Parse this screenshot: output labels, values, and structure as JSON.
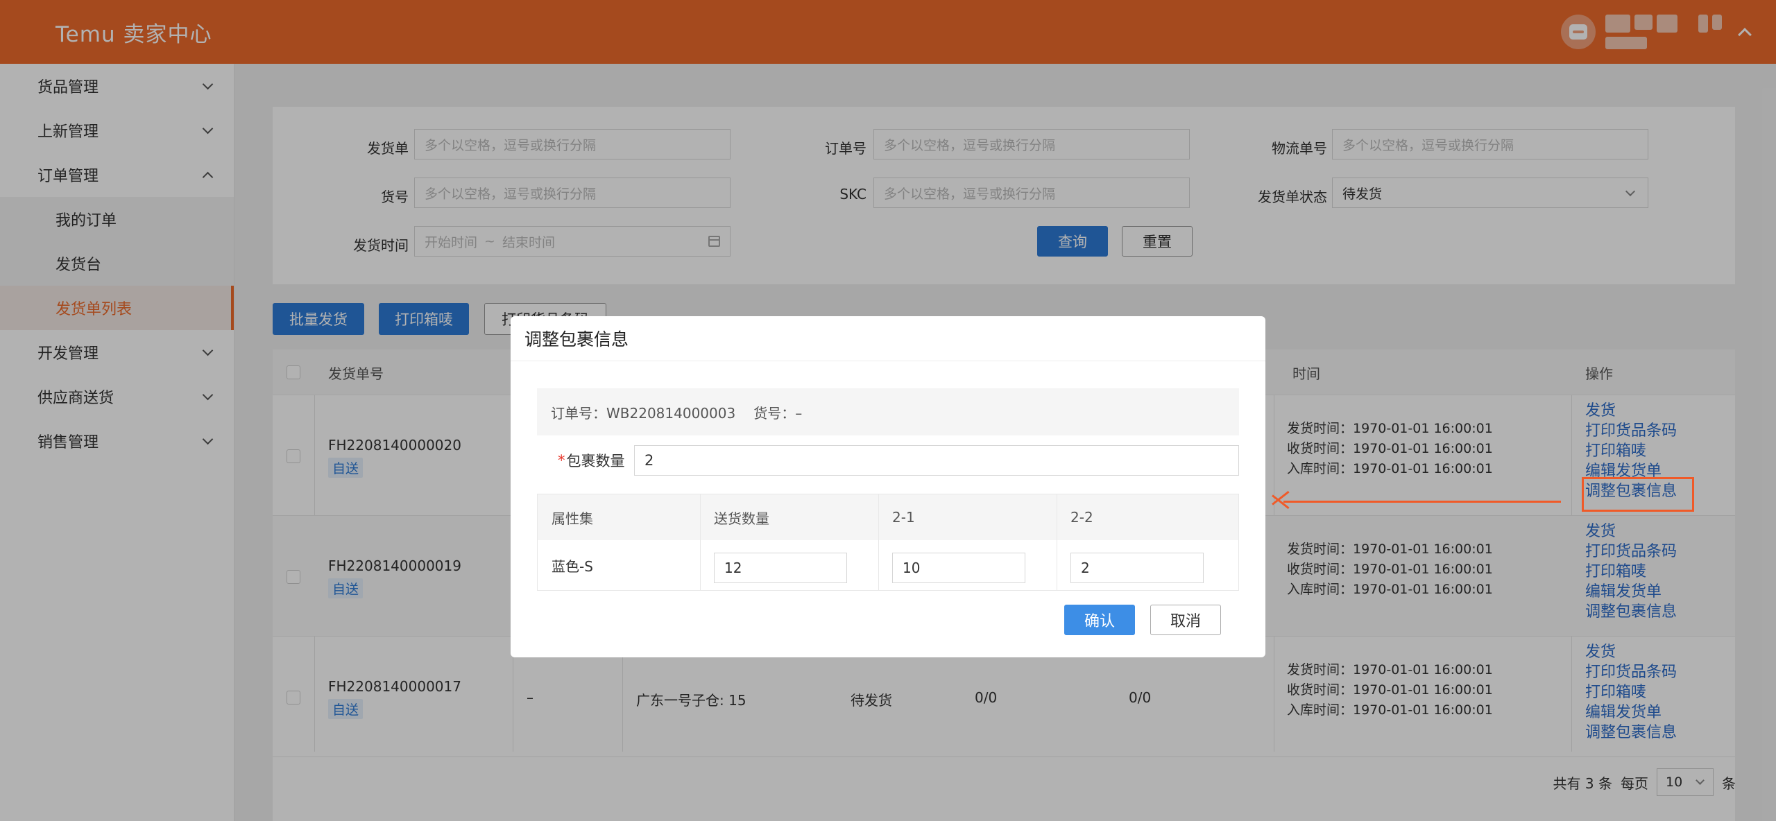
{
  "app": {
    "brand": "Temu 卖家中心"
  },
  "sidebar": {
    "items": [
      {
        "label": "货品管理"
      },
      {
        "label": "上新管理"
      },
      {
        "label": "订单管理"
      },
      {
        "label": "开发管理"
      },
      {
        "label": "供应商送货"
      },
      {
        "label": "销售管理"
      }
    ],
    "order_children": [
      {
        "label": "我的订单"
      },
      {
        "label": "发货台"
      },
      {
        "label": "发货单列表"
      }
    ]
  },
  "filters": {
    "shipment_no": {
      "label": "发货单",
      "placeholder": "多个以空格，逗号或换行分隔"
    },
    "order_no": {
      "label": "订单号",
      "placeholder": "多个以空格，逗号或换行分隔"
    },
    "logistics_no": {
      "label": "物流单号",
      "placeholder": "多个以空格，逗号或换行分隔"
    },
    "goods_no": {
      "label": "货号",
      "placeholder": "多个以空格，逗号或换行分隔"
    },
    "skc": {
      "label": "SKC",
      "placeholder": "多个以空格，逗号或换行分隔"
    },
    "status": {
      "label": "发货单状态",
      "value": "待发货"
    },
    "ship_time": {
      "label": "发货时间",
      "start_placeholder": "开始时间",
      "separator": "~",
      "end_placeholder": "结束时间"
    },
    "query_label": "查询",
    "reset_label": "重置"
  },
  "actions": {
    "batch_ship": "批量发货",
    "print_box": "打印箱唛",
    "print_barcode": "打印货品条码"
  },
  "table": {
    "headers": {
      "shipment_no": "发货单号",
      "time": "时间",
      "ops": "操作"
    },
    "rows": [
      {
        "id": "FH2208140000020",
        "tag": "自送",
        "times": [
          "发货时间：1970-01-01 16:00:01",
          "收货时间：1970-01-01 16:00:01",
          "入库时间：1970-01-01 16:00:01"
        ],
        "ops": [
          "发货",
          "打印货品条码",
          "打印箱唛",
          "编辑发货单",
          "调整包裹信息"
        ]
      },
      {
        "id": "FH2208140000019",
        "tag": "自送",
        "times": [
          "发货时间：1970-01-01 16:00:01",
          "收货时间：1970-01-01 16:00:01",
          "入库时间：1970-01-01 16:00:01"
        ],
        "ops": [
          "发货",
          "打印货品条码",
          "打印箱唛",
          "编辑发货单",
          "调整包裹信息"
        ]
      },
      {
        "id": "FH2208140000017",
        "tag": "自送",
        "col2": "–",
        "warehouse": "广东一号子仓: 15",
        "status": "待发货",
        "ratio1": "0/0",
        "ratio2": "0/0",
        "times": [
          "发货时间：1970-01-01 16:00:01",
          "收货时间：1970-01-01 16:00:01",
          "入库时间：1970-01-01 16:00:01"
        ],
        "ops": [
          "发货",
          "打印货品条码",
          "打印箱唛",
          "编辑发货单",
          "调整包裹信息"
        ]
      }
    ]
  },
  "pagination": {
    "total": "共有 3 条",
    "per_page_label": "每页",
    "per_page": "10",
    "unit": "条"
  },
  "modal": {
    "title": "调整包裹信息",
    "order_info": "订单号：WB220814000003",
    "goods_info": "货号：–",
    "qty_required_mark": "*",
    "qty_label": "包裹数量",
    "qty_value": "2",
    "headers": [
      "属性集",
      "送货数量",
      "2-1",
      "2-2"
    ],
    "row": {
      "attr": "蓝色-S",
      "delivery_qty": "12",
      "pkg1": "10",
      "pkg2": "2"
    },
    "confirm_label": "确认",
    "cancel_label": "取消"
  },
  "colors": {
    "brand": "#ec6b2c",
    "primary": "#2d7ad6",
    "link": "#2d6cc9",
    "annotation": "#f05a28"
  }
}
